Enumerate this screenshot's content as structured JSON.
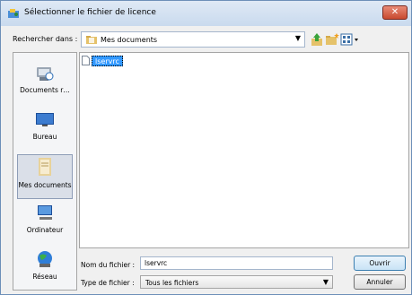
{
  "window": {
    "title": "Sélectionner le fichier de licence",
    "close_label": "✕"
  },
  "look_in": {
    "label": "Rechercher dans :",
    "value": "Mes documents"
  },
  "toolbar": {
    "up_icon": "up-folder-icon",
    "new_folder_icon": "new-folder-icon",
    "view_icon": "view-menu-icon"
  },
  "places": [
    {
      "label": "Documents r…",
      "icon": "recent-documents-icon",
      "selected": false
    },
    {
      "label": "Bureau",
      "icon": "desktop-icon",
      "selected": false
    },
    {
      "label": "Mes documents",
      "icon": "my-documents-icon",
      "selected": true
    },
    {
      "label": "Ordinateur",
      "icon": "computer-icon",
      "selected": false
    },
    {
      "label": "Réseau",
      "icon": "network-icon",
      "selected": false
    }
  ],
  "files": [
    {
      "name": "lservrc",
      "selected": true
    }
  ],
  "file_name": {
    "label": "Nom du fichier :",
    "value": "lservrc"
  },
  "file_type": {
    "label": "Type de fichier :",
    "value": "Tous les fichiers"
  },
  "buttons": {
    "open": "Ouvrir",
    "cancel": "Annuler"
  }
}
